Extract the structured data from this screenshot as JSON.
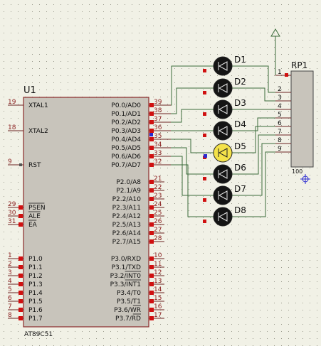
{
  "colors": {
    "background": "#f1f1e6",
    "grid_dot": "#9a9a8c",
    "chip_fill": "#c8c4bb",
    "chip_stroke": "#8a2a2a",
    "wire": "#3a6b3a",
    "pin_wire": "#6b2222",
    "pin_number": "#8a1e1e",
    "pin_square": "#d01010",
    "led_body": "#141414",
    "led_on": "#f4e24a",
    "text": "#111111",
    "probe": "#2a2ad0",
    "resistor_fill": "#c8c4bb"
  },
  "chip": {
    "ref": "U1",
    "part": "AT89C51",
    "left_pins": [
      {
        "num": "19",
        "name": "XTAL1",
        "overline": false
      },
      {
        "num": "18",
        "name": "XTAL2",
        "overline": false
      },
      {
        "num": "9",
        "name": "RST",
        "overline": false
      },
      {
        "num": "29",
        "name": "PSEN",
        "overline": true
      },
      {
        "num": "30",
        "name": "ALE",
        "overline": true
      },
      {
        "num": "31",
        "name": "EA",
        "overline": true
      },
      {
        "num": "1",
        "name": "P1.0",
        "overline": false
      },
      {
        "num": "2",
        "name": "P1.1",
        "overline": false
      },
      {
        "num": "3",
        "name": "P1.2",
        "overline": false
      },
      {
        "num": "4",
        "name": "P1.3",
        "overline": false
      },
      {
        "num": "5",
        "name": "P1.4",
        "overline": false
      },
      {
        "num": "6",
        "name": "P1.5",
        "overline": false
      },
      {
        "num": "7",
        "name": "P1.6",
        "overline": false
      },
      {
        "num": "8",
        "name": "P1.7",
        "overline": false
      }
    ],
    "right_pins": [
      {
        "num": "39",
        "name": "P0.0/AD0"
      },
      {
        "num": "38",
        "name": "P0.1/AD1"
      },
      {
        "num": "37",
        "name": "P0.2/AD2"
      },
      {
        "num": "36",
        "name": "P0.3/AD3"
      },
      {
        "num": "35",
        "name": "P0.4/AD4"
      },
      {
        "num": "34",
        "name": "P0.5/AD5"
      },
      {
        "num": "33",
        "name": "P0.6/AD6"
      },
      {
        "num": "32",
        "name": "P0.7/AD7"
      },
      {
        "num": "21",
        "name": "P2.0/A8"
      },
      {
        "num": "22",
        "name": "P2.1/A9"
      },
      {
        "num": "23",
        "name": "P2.2/A10"
      },
      {
        "num": "24",
        "name": "P2.3/A11"
      },
      {
        "num": "25",
        "name": "P2.4/A12"
      },
      {
        "num": "26",
        "name": "P2.5/A13"
      },
      {
        "num": "27",
        "name": "P2.6/A14"
      },
      {
        "num": "28",
        "name": "P2.7/A15"
      },
      {
        "num": "10",
        "name": "P3.0/RXD"
      },
      {
        "num": "11",
        "name": "P3.1/TXD"
      },
      {
        "num": "12",
        "name": "P3.2/INT0"
      },
      {
        "num": "13",
        "name": "P3.3/INT1"
      },
      {
        "num": "14",
        "name": "P3.4/T0"
      },
      {
        "num": "15",
        "name": "P3.5/T1"
      },
      {
        "num": "16",
        "name": "P3.6/WR"
      },
      {
        "num": "17",
        "name": "P3.7/RD"
      }
    ]
  },
  "leds": [
    {
      "label": "D1",
      "lit": false
    },
    {
      "label": "D2",
      "lit": false
    },
    {
      "label": "D3",
      "lit": false
    },
    {
      "label": "D4",
      "lit": false
    },
    {
      "label": "D5",
      "lit": true
    },
    {
      "label": "D6",
      "lit": false
    },
    {
      "label": "D7",
      "lit": false
    },
    {
      "label": "D8",
      "lit": false
    }
  ],
  "resistor_pack": {
    "ref": "RP1",
    "value": "100",
    "pins": [
      "1",
      "2",
      "3",
      "4",
      "5",
      "6",
      "7",
      "8",
      "9"
    ]
  },
  "icons": {
    "power": "power-terminal-icon",
    "led": "led-diode-icon",
    "crosshair": "origin-crosshair-icon"
  }
}
